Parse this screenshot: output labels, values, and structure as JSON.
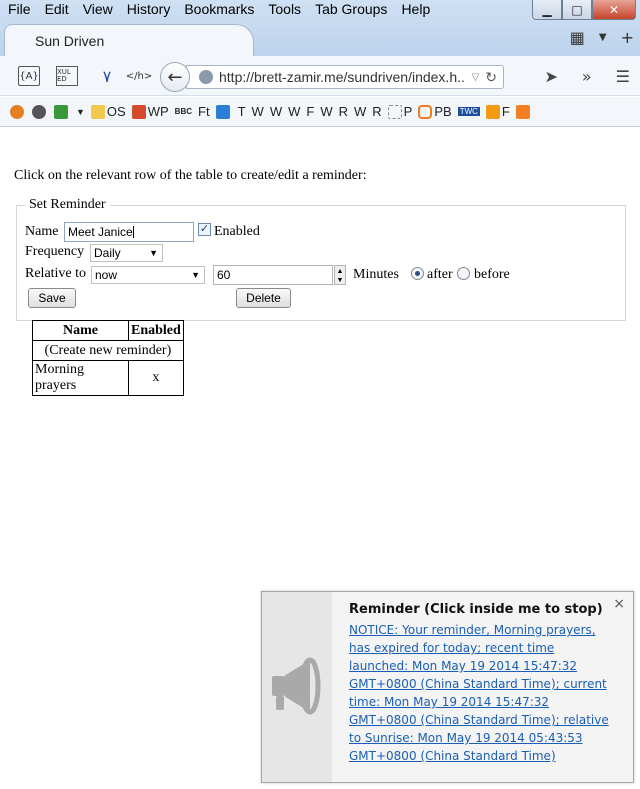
{
  "menu": [
    "File",
    "Edit",
    "View",
    "History",
    "Bookmarks",
    "Tools",
    "Tab Groups",
    "Help"
  ],
  "tab": {
    "title": "Sun Driven"
  },
  "toolbar": {
    "url": "http://brett-zamir.me/sundriven/index.h...",
    "icon_labels": [
      "{A}",
      "XUL ED",
      "</h>"
    ]
  },
  "bookmarks": [
    "OS",
    "WP",
    "BBC",
    "Ft",
    "T",
    "W",
    "W",
    "W",
    "F",
    "W",
    "R",
    "W",
    "R",
    "P",
    "PB",
    "TWC",
    "F"
  ],
  "page": {
    "instruction": "Click on the relevant row of the table to create/edit a reminder:",
    "form": {
      "legend": "Set Reminder",
      "name_label": "Name",
      "name_value": "Meet Janice",
      "enabled_label": "Enabled",
      "frequency_label": "Frequency",
      "frequency_value": "Daily",
      "relative_label": "Relative to",
      "relative_value": "now",
      "minutes_value": "60",
      "minutes_label": "Minutes",
      "after_label": "after",
      "before_label": "before",
      "save_label": "Save",
      "delete_label": "Delete"
    },
    "table": {
      "headers": [
        "Name",
        "Enabled"
      ],
      "create_row": "(Create new reminder)",
      "rows": [
        {
          "name": "Morning prayers",
          "enabled": "x"
        }
      ]
    }
  },
  "notification": {
    "title": "Reminder (Click inside me to stop)",
    "close": "×",
    "message": "NOTICE: Your reminder, Morning prayers, has expired for today; recent time launched: Mon May 19 2014 15:47:32 GMT+0800 (China Standard Time); current time: Mon May 19 2014 15:47:32 GMT+0800 (China Standard Time); relative to Sunrise: Mon May 19 2014 05:43:53 GMT+0800 (China Standard Time)"
  }
}
